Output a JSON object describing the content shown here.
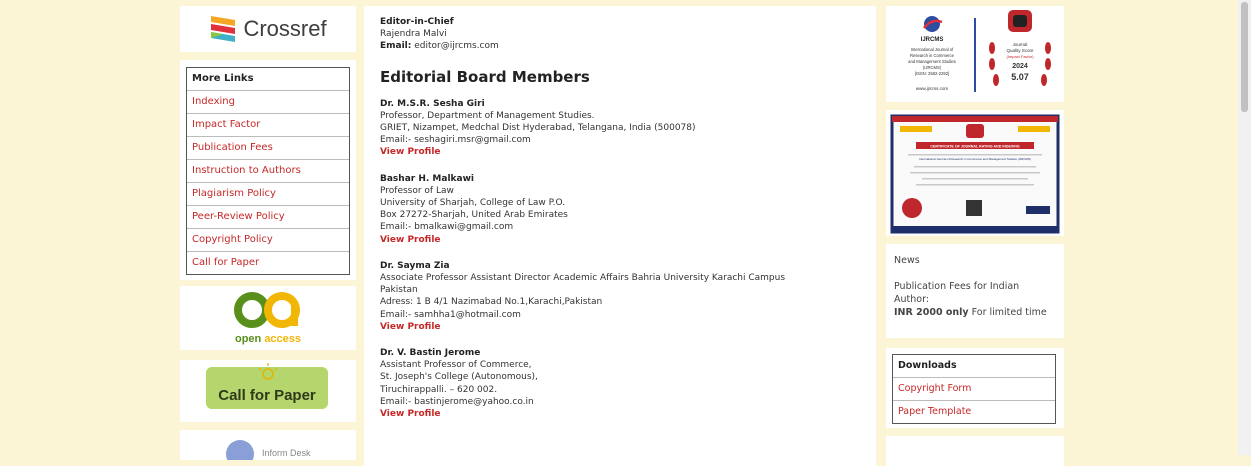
{
  "logos": {
    "crossref": "Crossref",
    "open_access": "open access",
    "call_for_paper": "Call for Paper",
    "left_bottom_text": "Inform Desk"
  },
  "more_links": {
    "title": "More Links",
    "items": [
      "Indexing",
      "Impact Factor",
      "Publication Fees",
      "Instruction to Authors",
      "Plagiarism Policy",
      "Peer-Review Policy",
      "Copyright Policy",
      "Call for Paper"
    ]
  },
  "editor": {
    "label": "Editor-in-Chief",
    "name": "Rajendra Malvi",
    "email_label": "Email:",
    "email": "editor@ijrcms.com"
  },
  "board": {
    "heading": "Editorial Board Members",
    "view_profile": "View Profile",
    "members": [
      {
        "name": "Dr. M.S.R. Sesha Giri",
        "lines": [
          "Professor, Department of Management Studies.",
          "GRIET, Nizampet, Medchal Dist Hyderabad, Telangana, India (500078)",
          "Email:- seshagiri.msr@gmail.com"
        ]
      },
      {
        "name": "Bashar H. Malkawi",
        "lines": [
          "Professor of Law",
          "University of Sharjah, College of Law P.O.",
          "Box 27272-Sharjah, United Arab Emirates",
          "Email:- bmalkawi@gmail.com"
        ]
      },
      {
        "name": "Dr. Sayma Zia",
        "lines": [
          "Associate Professor Assistant Director Academic Affairs Bahria University Karachi Campus",
          "Pakistan",
          "Adress: 1 B 4/1 Nazimabad No.1,Karachi,Pakistan",
          "Email:- samhha1@hotmail.com"
        ]
      },
      {
        "name": "Dr. V. Bastin Jerome",
        "lines": [
          "Assistant Professor of Commerce,",
          "St. Joseph's College (Autonomous),",
          "Tiruchirappalli. – 620 002.",
          "Email:- bastinjerome@yahoo.co.in"
        ]
      }
    ]
  },
  "badge": {
    "org": "IJRCMS",
    "journal_lines": [
      "International Journal of",
      "Research in Commerce",
      "and Management Studies",
      "(IJRCMS)",
      "[ISSN: 2582-2292]"
    ],
    "url": "www.ijrcms.com",
    "score_lines": [
      "Journal",
      "Quality Score",
      "(Impact Factor)"
    ],
    "year": "2024",
    "score": "5.07"
  },
  "certificate": {
    "title": "CERTIFICATE OF JOURNAL RATING AND INDEXING",
    "journal": "International Journal of Research in Commerce and Management Studies (IJRCMS)"
  },
  "news": {
    "title": "News",
    "text": "Publication Fees for Indian Author:",
    "bold": "INR 2000 only",
    "rest": " For limited time"
  },
  "downloads": {
    "title": "Downloads",
    "items": [
      "Copyright Form",
      "Paper Template"
    ]
  },
  "colors": {
    "page_bg": "#fbf5d5",
    "link_red": "#c62828",
    "crossref_orange": "#f5a623",
    "crossref_red": "#e0303a",
    "crossref_blue": "#3eb1c8",
    "oa_green": "#5a8f1b",
    "oa_yellow": "#f2b705",
    "call_green": "#b4d66d"
  }
}
